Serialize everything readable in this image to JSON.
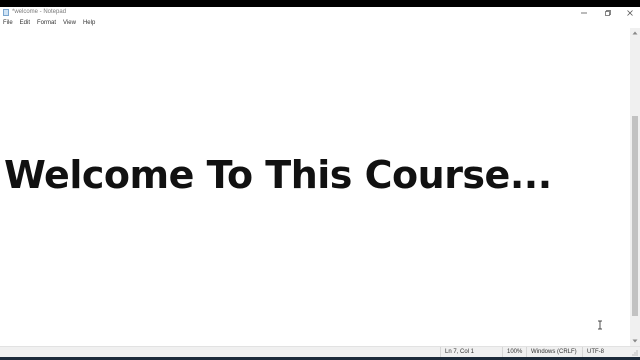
{
  "window": {
    "title": "*welcome - Notepad",
    "icon": "notepad-icon",
    "controls": [
      "minimize-icon",
      "maximize-icon",
      "close-icon"
    ]
  },
  "menu": {
    "items": [
      {
        "label": "File"
      },
      {
        "label": "Edit"
      },
      {
        "label": "Format"
      },
      {
        "label": "View"
      },
      {
        "label": "Help"
      }
    ]
  },
  "editor": {
    "text": "Welcome To This Course..."
  },
  "status": {
    "position": "Ln 7, Col 1",
    "zoom": "100%",
    "line_ending": "Windows (CRLF)",
    "encoding": "UTF-8"
  },
  "colors": {
    "background": "#ffffff",
    "text": "#111111",
    "chrome": "#f0f0f0"
  }
}
